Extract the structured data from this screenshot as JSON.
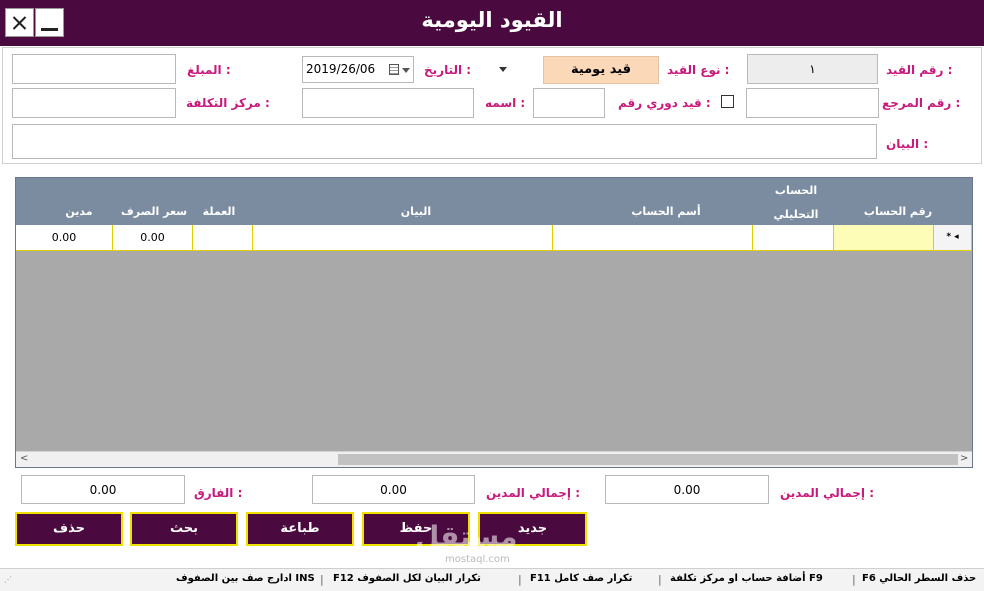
{
  "window": {
    "title": "القيود اليومية"
  },
  "form": {
    "entry_no_label": "رقم القيد :",
    "entry_no_value": "١",
    "entry_type_label": "نوع القيد :",
    "entry_type_value": "قيد يومية",
    "date_label": "التاريخ :",
    "date_value": "2019/26/06",
    "amount_label": "المبلغ :",
    "amount_value": "",
    "ref_no_label": "رقم المرجع :",
    "ref_no_value": "",
    "periodic_label": "قيد دوري رقم :",
    "periodic_value": "",
    "name_label": "اسمه :",
    "name_value": "",
    "cost_center_label": "مركز التكلفة :",
    "cost_center_value": "",
    "statement_label": "البيان :",
    "statement_value": ""
  },
  "grid": {
    "columns": {
      "account_no": "رقم الحساب",
      "analytic_top": "الحساب",
      "analytic_bottom": "التحليلي",
      "account_name": "أسم الحساب",
      "statement": "البيان",
      "currency": "العملة",
      "rate": "سعر الصرف",
      "debit": "مدين"
    },
    "new_row": {
      "marker": "*",
      "account_no": "",
      "analytic": "",
      "account_name": "",
      "statement": "",
      "currency": "",
      "rate": "0.00",
      "debit": "0.00"
    }
  },
  "totals": {
    "total_debit_1_label": "إجمالي المدين :",
    "total_debit_1_value": "0.00",
    "total_debit_2_label": "إجمالي المدين :",
    "total_debit_2_value": "0.00",
    "difference_label": "الفارق :",
    "difference_value": "0.00"
  },
  "buttons": {
    "new": "جديد",
    "save": "حفظ",
    "print": "طباعة",
    "search": "بحث",
    "delete": "حذف"
  },
  "statusbar": {
    "f6": "F6 حذف السطر الحالي",
    "f9": "أضافة حساب او مركز تكلفة F9",
    "f11": "F11 تكرار صف كامل",
    "f12": "F12 تكرار البيان لكل الصفوف",
    "ins": "ادارج صف بين الصفوف INS"
  },
  "watermark": {
    "main": "مستقل",
    "sub": "mostaql.com"
  },
  "colors": {
    "titlebar": "#4b0a3f",
    "label": "#c71a7c",
    "button_border": "#f0e200",
    "grid_header": "#7b8ba0"
  }
}
